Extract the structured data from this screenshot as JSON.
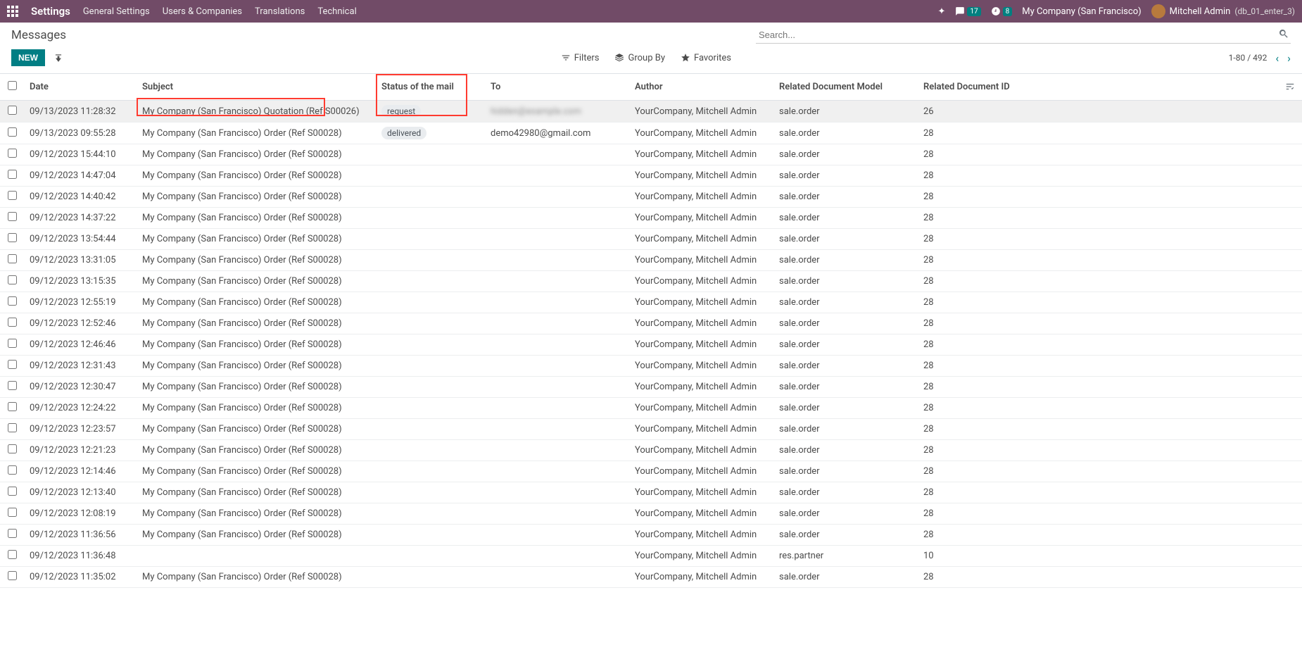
{
  "top_nav": {
    "title": "Settings",
    "menu": [
      "General Settings",
      "Users & Companies",
      "Translations",
      "Technical"
    ],
    "msg_count": "17",
    "activity_count": "8",
    "company": "My Company (San Francisco)",
    "user_name": "Mitchell Admin",
    "db_name": "(db_01_enter_3)"
  },
  "breadcrumb": "Messages",
  "search_placeholder": "Search...",
  "buttons": {
    "new": "NEW",
    "filters": "Filters",
    "group_by": "Group By",
    "favorites": "Favorites"
  },
  "pager": "1-80 / 492",
  "columns": {
    "date": "Date",
    "subject": "Subject",
    "status": "Status of the mail",
    "to": "To",
    "author": "Author",
    "model": "Related Document Model",
    "docid": "Related Document ID"
  },
  "rows": [
    {
      "date": "09/13/2023 11:28:32",
      "subject": "My Company (San Francisco) Quotation (Ref S00026)",
      "status": "request",
      "to": "hidden@example.com",
      "to_blur": true,
      "author": "YourCompany, Mitchell Admin",
      "model": "sale.order",
      "docid": "26",
      "hovered": true
    },
    {
      "date": "09/13/2023 09:55:28",
      "subject": "My Company (San Francisco) Order (Ref S00028)",
      "status": "delivered",
      "to": "demo42980@gmail.com",
      "author": "YourCompany, Mitchell Admin",
      "model": "sale.order",
      "docid": "28"
    },
    {
      "date": "09/12/2023 15:44:10",
      "subject": "My Company (San Francisco) Order (Ref S00028)",
      "status": "",
      "to": "",
      "author": "YourCompany, Mitchell Admin",
      "model": "sale.order",
      "docid": "28"
    },
    {
      "date": "09/12/2023 14:47:04",
      "subject": "My Company (San Francisco) Order (Ref S00028)",
      "status": "",
      "to": "",
      "author": "YourCompany, Mitchell Admin",
      "model": "sale.order",
      "docid": "28"
    },
    {
      "date": "09/12/2023 14:40:42",
      "subject": "My Company (San Francisco) Order (Ref S00028)",
      "status": "",
      "to": "",
      "author": "YourCompany, Mitchell Admin",
      "model": "sale.order",
      "docid": "28"
    },
    {
      "date": "09/12/2023 14:37:22",
      "subject": "My Company (San Francisco) Order (Ref S00028)",
      "status": "",
      "to": "",
      "author": "YourCompany, Mitchell Admin",
      "model": "sale.order",
      "docid": "28"
    },
    {
      "date": "09/12/2023 13:54:44",
      "subject": "My Company (San Francisco) Order (Ref S00028)",
      "status": "",
      "to": "",
      "author": "YourCompany, Mitchell Admin",
      "model": "sale.order",
      "docid": "28"
    },
    {
      "date": "09/12/2023 13:31:05",
      "subject": "My Company (San Francisco) Order (Ref S00028)",
      "status": "",
      "to": "",
      "author": "YourCompany, Mitchell Admin",
      "model": "sale.order",
      "docid": "28"
    },
    {
      "date": "09/12/2023 13:15:35",
      "subject": "My Company (San Francisco) Order (Ref S00028)",
      "status": "",
      "to": "",
      "author": "YourCompany, Mitchell Admin",
      "model": "sale.order",
      "docid": "28"
    },
    {
      "date": "09/12/2023 12:55:19",
      "subject": "My Company (San Francisco) Order (Ref S00028)",
      "status": "",
      "to": "",
      "author": "YourCompany, Mitchell Admin",
      "model": "sale.order",
      "docid": "28"
    },
    {
      "date": "09/12/2023 12:52:46",
      "subject": "My Company (San Francisco) Order (Ref S00028)",
      "status": "",
      "to": "",
      "author": "YourCompany, Mitchell Admin",
      "model": "sale.order",
      "docid": "28"
    },
    {
      "date": "09/12/2023 12:46:46",
      "subject": "My Company (San Francisco) Order (Ref S00028)",
      "status": "",
      "to": "",
      "author": "YourCompany, Mitchell Admin",
      "model": "sale.order",
      "docid": "28"
    },
    {
      "date": "09/12/2023 12:31:43",
      "subject": "My Company (San Francisco) Order (Ref S00028)",
      "status": "",
      "to": "",
      "author": "YourCompany, Mitchell Admin",
      "model": "sale.order",
      "docid": "28"
    },
    {
      "date": "09/12/2023 12:30:47",
      "subject": "My Company (San Francisco) Order (Ref S00028)",
      "status": "",
      "to": "",
      "author": "YourCompany, Mitchell Admin",
      "model": "sale.order",
      "docid": "28"
    },
    {
      "date": "09/12/2023 12:24:22",
      "subject": "My Company (San Francisco) Order (Ref S00028)",
      "status": "",
      "to": "",
      "author": "YourCompany, Mitchell Admin",
      "model": "sale.order",
      "docid": "28"
    },
    {
      "date": "09/12/2023 12:23:57",
      "subject": "My Company (San Francisco) Order (Ref S00028)",
      "status": "",
      "to": "",
      "author": "YourCompany, Mitchell Admin",
      "model": "sale.order",
      "docid": "28"
    },
    {
      "date": "09/12/2023 12:21:23",
      "subject": "My Company (San Francisco) Order (Ref S00028)",
      "status": "",
      "to": "",
      "author": "YourCompany, Mitchell Admin",
      "model": "sale.order",
      "docid": "28"
    },
    {
      "date": "09/12/2023 12:14:46",
      "subject": "My Company (San Francisco) Order (Ref S00028)",
      "status": "",
      "to": "",
      "author": "YourCompany, Mitchell Admin",
      "model": "sale.order",
      "docid": "28"
    },
    {
      "date": "09/12/2023 12:13:40",
      "subject": "My Company (San Francisco) Order (Ref S00028)",
      "status": "",
      "to": "",
      "author": "YourCompany, Mitchell Admin",
      "model": "sale.order",
      "docid": "28"
    },
    {
      "date": "09/12/2023 12:08:19",
      "subject": "My Company (San Francisco) Order (Ref S00028)",
      "status": "",
      "to": "",
      "author": "YourCompany, Mitchell Admin",
      "model": "sale.order",
      "docid": "28"
    },
    {
      "date": "09/12/2023 11:36:56",
      "subject": "My Company (San Francisco) Order (Ref S00028)",
      "status": "",
      "to": "",
      "author": "YourCompany, Mitchell Admin",
      "model": "sale.order",
      "docid": "28"
    },
    {
      "date": "09/12/2023 11:36:48",
      "subject": "",
      "status": "",
      "to": "",
      "author": "YourCompany, Mitchell Admin",
      "model": "res.partner",
      "docid": "10"
    },
    {
      "date": "09/12/2023 11:35:02",
      "subject": "My Company (San Francisco) Order (Ref S00028)",
      "status": "",
      "to": "",
      "author": "YourCompany, Mitchell Admin",
      "model": "sale.order",
      "docid": "28"
    }
  ]
}
